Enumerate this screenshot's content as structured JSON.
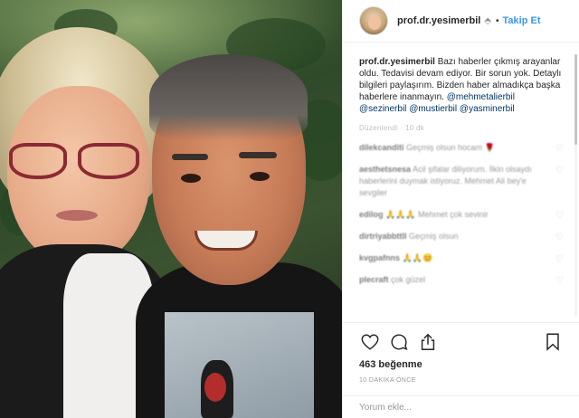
{
  "header": {
    "username": "prof.dr.yesimerbil",
    "verified_glyph": "⬘",
    "separator": "•",
    "follow_label": "Takip Et"
  },
  "caption": {
    "user": "prof.dr.yesimerbil",
    "text": "Bazı haberler çıkmış arayanlar oldu. Tedavisi devam ediyor. Bir sorun yok. Detaylı bilgileri paylaşırım. Bizden haber almadıkça başka haberlere inanmayın.",
    "mentions": [
      "@mehmetalierbil",
      "@sezinerbil",
      "@mustierbil",
      "@yasminerbil"
    ],
    "meta": "Düzenlendi · 10 dk"
  },
  "comments": [
    {
      "user": "dilekcanditi",
      "text": "Geçmiş olsun hocam 🌹"
    },
    {
      "user": "aesthetsnesa",
      "text": "Acil şifalar diliyorum. İlkin olsaydı haberlerini duymak istiyoruz. Mehmet Ali bey'e sevgiler"
    },
    {
      "user": "edilog",
      "text": "🙏🙏🙏 Mehmet çok sevinir"
    },
    {
      "user": "dirtriyabbttll",
      "text": "Geçmiş olsun"
    },
    {
      "user": "kvgpafnns",
      "text": "🙏🙏😊"
    },
    {
      "user": "plecraft",
      "text": "çok güzel"
    }
  ],
  "actions": {
    "icons": [
      "heart-icon",
      "comment-icon",
      "share-icon",
      "bookmark-icon"
    ]
  },
  "likes": "463 beğenme",
  "time": "10 DAKİKA ÖNCE",
  "add_comment": {
    "placeholder": "Yorum ekle..."
  }
}
